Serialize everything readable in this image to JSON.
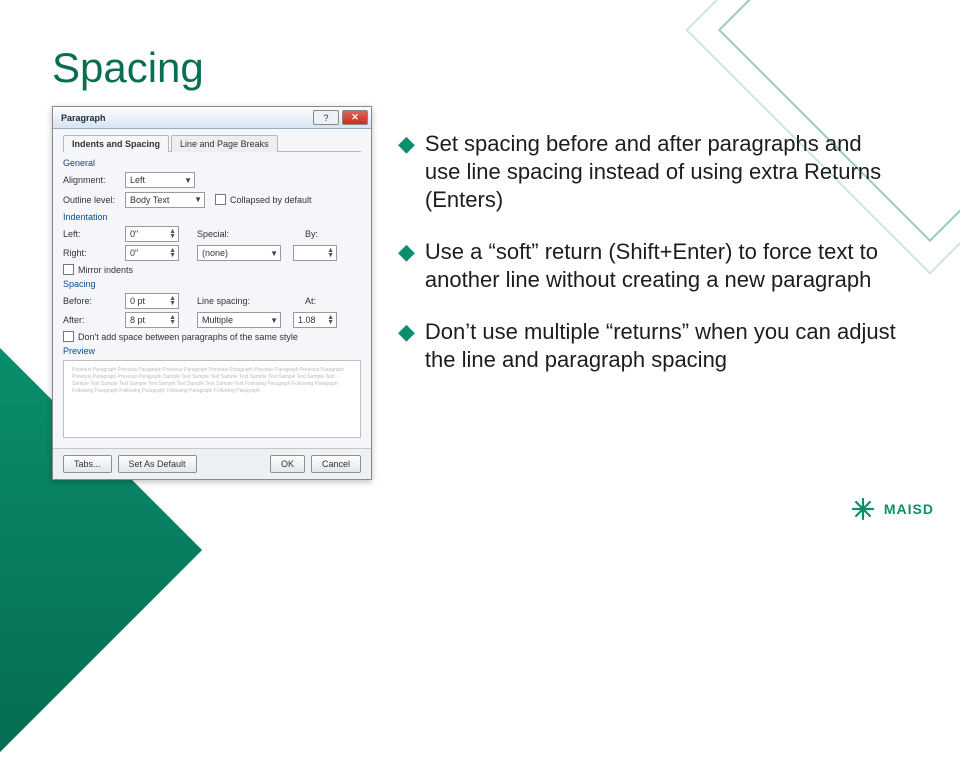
{
  "title": "Spacing",
  "dialog": {
    "title": "Paragraph",
    "tabs": [
      "Indents and Spacing",
      "Line and Page Breaks"
    ],
    "general_label": "General",
    "alignment_label": "Alignment:",
    "alignment_value": "Left",
    "outline_label": "Outline level:",
    "outline_value": "Body Text",
    "collapse_label": "Collapsed by default",
    "indent_label": "Indentation",
    "left_label": "Left:",
    "left_value": "0\"",
    "right_label": "Right:",
    "right_value": "0\"",
    "special_label": "Special:",
    "special_value": "(none)",
    "by_label": "By:",
    "mirror_label": "Mirror indents",
    "spacing_label": "Spacing",
    "before_label": "Before:",
    "before_value": "0 pt",
    "after_label": "After:",
    "after_value": "8 pt",
    "line_spacing_label": "Line spacing:",
    "line_spacing_value": "Multiple",
    "at_label": "At:",
    "at_value": "1.08",
    "no_space_label": "Don't add space between paragraphs of the same style",
    "preview_label": "Preview",
    "preview_text": "Previous Paragraph Previous Paragraph Previous Paragraph Previous Paragraph Previous Paragraph Previous Paragraph Previous Paragraph Previous Paragraph\nSample Text Sample Text Sample Text Sample Text Sample Text Sample Text Sample Text Sample Text Sample Text Sample Text Sample Text Sample Text\nFollowing Paragraph Following Paragraph Following Paragraph Following Paragraph Following Paragraph Following Paragraph",
    "btn_tabs": "Tabs...",
    "btn_default": "Set As Default",
    "btn_ok": "OK",
    "btn_cancel": "Cancel"
  },
  "bullets": [
    "Set spacing before and after paragraphs and use line spacing instead of using extra Returns (Enters)",
    "Use a “soft” return (Shift+Enter) to force text to another line without creating a new paragraph",
    "Don’t use multiple “returns” when you can adjust the line and paragraph spacing"
  ],
  "logo_text": "MAISD"
}
